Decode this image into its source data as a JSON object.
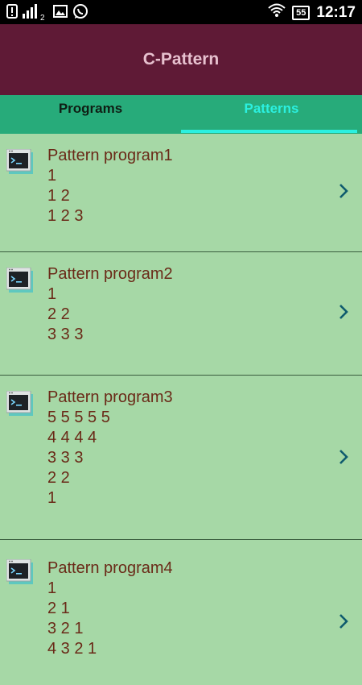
{
  "status": {
    "sim_sub": "2",
    "battery": "55",
    "time": "12:17"
  },
  "app": {
    "title": "C-Pattern"
  },
  "tabs": [
    {
      "label": "Programs",
      "active": false
    },
    {
      "label": "Patterns",
      "active": true
    }
  ],
  "items": [
    {
      "title": "Pattern program1",
      "lines": [
        "1",
        "1 2",
        "1 2 3"
      ]
    },
    {
      "title": "Pattern program2",
      "lines": [
        "1",
        "2 2",
        "3 3 3"
      ]
    },
    {
      "title": "Pattern program3",
      "lines": [
        "5 5 5 5 5",
        "4 4 4 4",
        "3 3 3",
        "2 2",
        "1"
      ]
    },
    {
      "title": "Pattern program4",
      "lines": [
        "1",
        "2 1",
        "3 2 1",
        "4 3 2 1"
      ]
    }
  ],
  "colors": {
    "appbar": "#5f1a36",
    "tabbar": "#27ab7a",
    "active_tab": "#2bf0e0",
    "list_bg": "#a6d8a6",
    "item_text": "#6a2a18"
  },
  "icons": {
    "item_icon": "terminal-icon",
    "item_action": "chevron-right-icon"
  }
}
